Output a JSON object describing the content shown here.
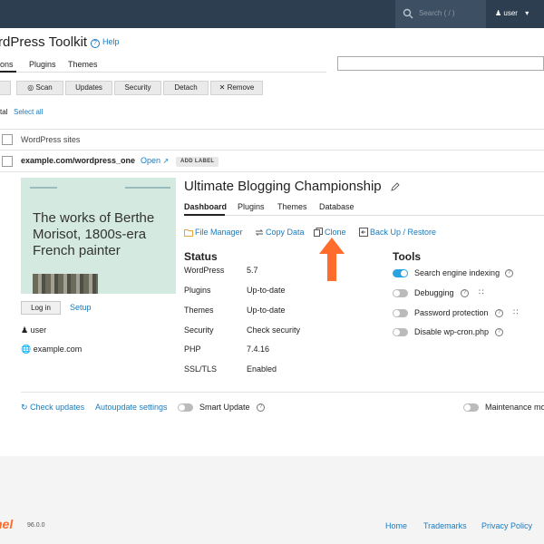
{
  "topbar": {
    "search_placeholder": "Search ( / )",
    "user": "user"
  },
  "page": {
    "title": "rdPress Toolkit",
    "help": "Help",
    "tabs": [
      "ions",
      "Plugins",
      "Themes"
    ]
  },
  "toolbar": {
    "scan": "Scan",
    "updates": "Updates",
    "security": "Security",
    "detach": "Detach",
    "remove": "Remove"
  },
  "list": {
    "total": "tal",
    "select_all": "Select all",
    "header": "WordPress sites"
  },
  "site": {
    "url": "example.com/wordpress_one",
    "open": "Open",
    "add_label": "ADD LABEL",
    "preview_text": "The works of Berthe Morisot, 1800s-era French painter",
    "login": "Log in",
    "setup": "Setup",
    "user": "user",
    "domain": "example.com",
    "title": "Ultimate Blogging Championship",
    "tabs": [
      "Dashboard",
      "Plugins",
      "Themes",
      "Database"
    ],
    "actions": {
      "file_manager": "File Manager",
      "copy_data": "Copy Data",
      "clone": "Clone",
      "backup": "Back Up / Restore"
    },
    "status": {
      "heading": "Status",
      "rows": [
        {
          "label": "WordPress",
          "value": "5.7"
        },
        {
          "label": "Plugins",
          "value": "Up-to-date"
        },
        {
          "label": "Themes",
          "value": "Up-to-date"
        },
        {
          "label": "Security",
          "value": "Check security"
        },
        {
          "label": "PHP",
          "value": "7.4.16"
        },
        {
          "label": "SSL/TLS",
          "value": "Enabled"
        }
      ]
    },
    "tools": {
      "heading": "Tools",
      "items": [
        {
          "label": "Search engine indexing",
          "on": true
        },
        {
          "label": "Debugging",
          "on": false
        },
        {
          "label": "Password protection",
          "on": false
        },
        {
          "label": "Disable wp-cron.php",
          "on": false
        }
      ]
    },
    "bottom": {
      "check_updates": "Check updates",
      "autoupdate": "Autoupdate settings",
      "smart_update": "Smart Update",
      "maintenance": "Maintenance mo"
    }
  },
  "footer": {
    "logo": "nel",
    "version": "96.0.0",
    "links": [
      "Home",
      "Trademarks",
      "Privacy Policy"
    ]
  },
  "colors": {
    "accent": "#1a7bbf",
    "topbar": "#2c3e50",
    "arrow": "#ff6c2c",
    "toggle_on": "#28a3e0"
  }
}
